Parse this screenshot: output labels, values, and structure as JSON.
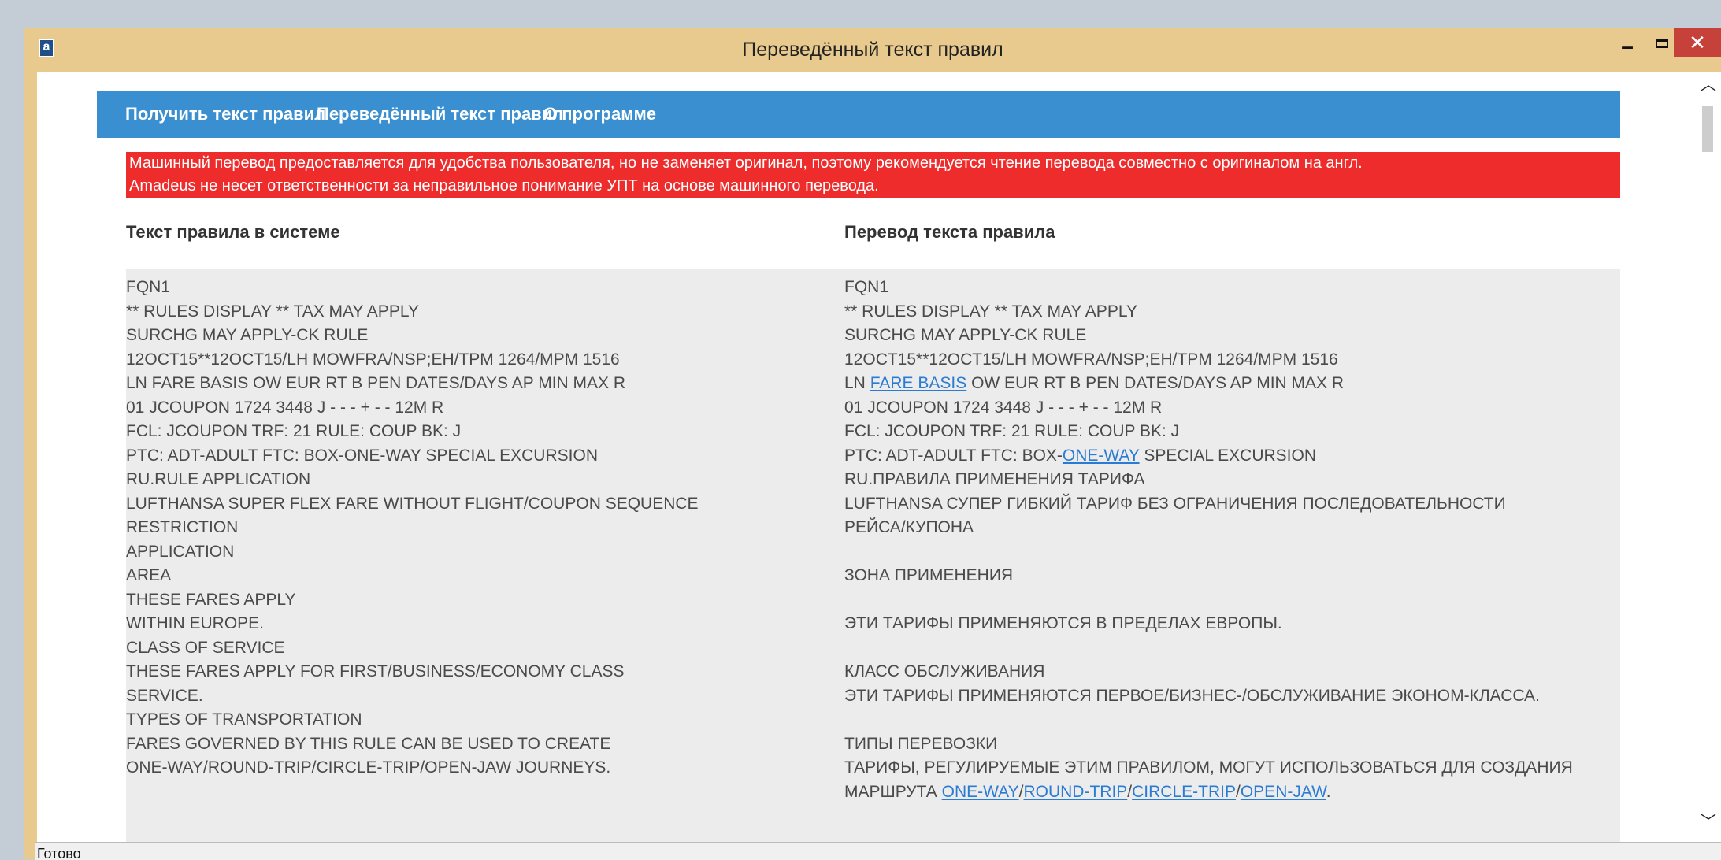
{
  "window": {
    "title": "Переведённый текст правил",
    "icon": "app-icon",
    "controls": {
      "minimize": "–",
      "close": "✕"
    }
  },
  "nav": {
    "items": [
      "Получить текст правил",
      "Переведённый текст правил",
      "О программе"
    ]
  },
  "warning": {
    "line1": "Машинный перевод предоставляется для удобства пользователя, но не заменяет оригинал, поэтому рекомендуется чтение перевода совместно с оригиналом на англ.",
    "line2": "Amadeus не несет ответственности за неправильное понимание УПТ на основе машинного перевода."
  },
  "columns": {
    "original_header": "Текст правила в системе",
    "translation_header": "Перевод текста правила"
  },
  "original_lines": [
    "FQN1",
    "** RULES DISPLAY ** TAX MAY APPLY",
    "SURCHG MAY APPLY-CK RULE",
    "12OCT15**12OCT15/LH MOWFRA/NSP;EH/TPM 1264/MPM 1516",
    "LN FARE BASIS OW EUR RT B PEN DATES/DAYS AP MIN MAX R",
    "01 JCOUPON 1724 3448 J - - - + - - 12M R",
    "FCL: JCOUPON TRF: 21 RULE: COUP BK: J",
    "PTC: ADT-ADULT FTC: BOX-ONE-WAY SPECIAL EXCURSION",
    "RU.RULE APPLICATION",
    "LUFTHANSA SUPER FLEX FARE WITHOUT FLIGHT/COUPON SEQUENCE",
    "RESTRICTION",
    "APPLICATION",
    "AREA",
    "THESE FARES APPLY",
    "WITHIN EUROPE.",
    "CLASS OF SERVICE",
    "THESE FARES APPLY FOR FIRST/BUSINESS/ECONOMY CLASS",
    "SERVICE.",
    "TYPES OF TRANSPORTATION",
    "FARES GOVERNED BY THIS RULE CAN BE USED TO CREATE",
    "ONE-WAY/ROUND-TRIP/CIRCLE-TRIP/OPEN-JAW JOURNEYS."
  ],
  "translated_lines": [
    [
      {
        "t": "FQN1"
      }
    ],
    [
      {
        "t": "** RULES DISPLAY ** TAX MAY APPLY"
      }
    ],
    [
      {
        "t": "SURCHG MAY APPLY-CK RULE"
      }
    ],
    [
      {
        "t": "12OCT15**12OCT15/LH MOWFRA/NSP;EH/TPM 1264/MPM 1516"
      }
    ],
    [
      {
        "t": "LN "
      },
      {
        "t": "FARE BASIS",
        "link": true
      },
      {
        "t": " OW EUR RT B PEN DATES/DAYS AP MIN MAX R"
      }
    ],
    [
      {
        "t": "01 JCOUPON 1724 3448 J - - - + - - 12M R"
      }
    ],
    [
      {
        "t": "FCL: JCOUPON TRF: 21 RULE: COUP BK: J"
      }
    ],
    [
      {
        "t": "PTC: ADT-ADULT FTC: BOX-"
      },
      {
        "t": "ONE-WAY",
        "link": true
      },
      {
        "t": " SPECIAL EXCURSION"
      }
    ],
    [
      {
        "t": "RU.ПРАВИЛА ПРИМЕНЕНИЯ ТАРИФА"
      }
    ],
    [
      {
        "t": "LUFTHANSA СУПЕР ГИБКИЙ ТАРИФ БЕЗ ОГРАНИЧЕНИЯ ПОСЛЕДОВАТЕЛЬНОСТИ"
      }
    ],
    [
      {
        "t": "РЕЙСА/КУПОНА"
      }
    ],
    [],
    [
      {
        "t": "ЗОНА ПРИМЕНЕНИЯ"
      }
    ],
    [],
    [
      {
        "t": "ЭТИ ТАРИФЫ ПРИМЕНЯЮТСЯ В ПРЕДЕЛАХ ЕВРОПЫ."
      }
    ],
    [],
    [
      {
        "t": "КЛАСС ОБСЛУЖИВАНИЯ"
      }
    ],
    [
      {
        "t": "ЭТИ ТАРИФЫ ПРИМЕНЯЮТСЯ ПЕРВОЕ/БИЗНЕС-/ОБСЛУЖИВАНИЕ ЭКОНОМ-КЛАССА."
      }
    ],
    [],
    [
      {
        "t": "ТИПЫ ПЕРЕВОЗКИ"
      }
    ],
    [
      {
        "t": "ТАРИФЫ, РЕГУЛИРУЕМЫЕ ЭТИМ ПРАВИЛОМ, МОГУТ ИСПОЛЬЗОВАТЬСЯ ДЛЯ СОЗДАНИЯ"
      }
    ],
    [
      {
        "t": "МАРШРУТА "
      },
      {
        "t": "ONE-WAY",
        "link": true
      },
      {
        "t": "/"
      },
      {
        "t": "ROUND-TRIP",
        "link": true
      },
      {
        "t": "/"
      },
      {
        "t": "CIRCLE-TRIP",
        "link": true
      },
      {
        "t": "/"
      },
      {
        "t": "OPEN-JAW",
        "link": true
      },
      {
        "t": "."
      }
    ]
  ],
  "status": {
    "text": "Готово"
  },
  "colors": {
    "titlebar": "#e8ca8e",
    "nav": "#3a8fd0",
    "warning": "#ee2c2c",
    "link": "#2a7bd3",
    "close": "#c7413b"
  }
}
